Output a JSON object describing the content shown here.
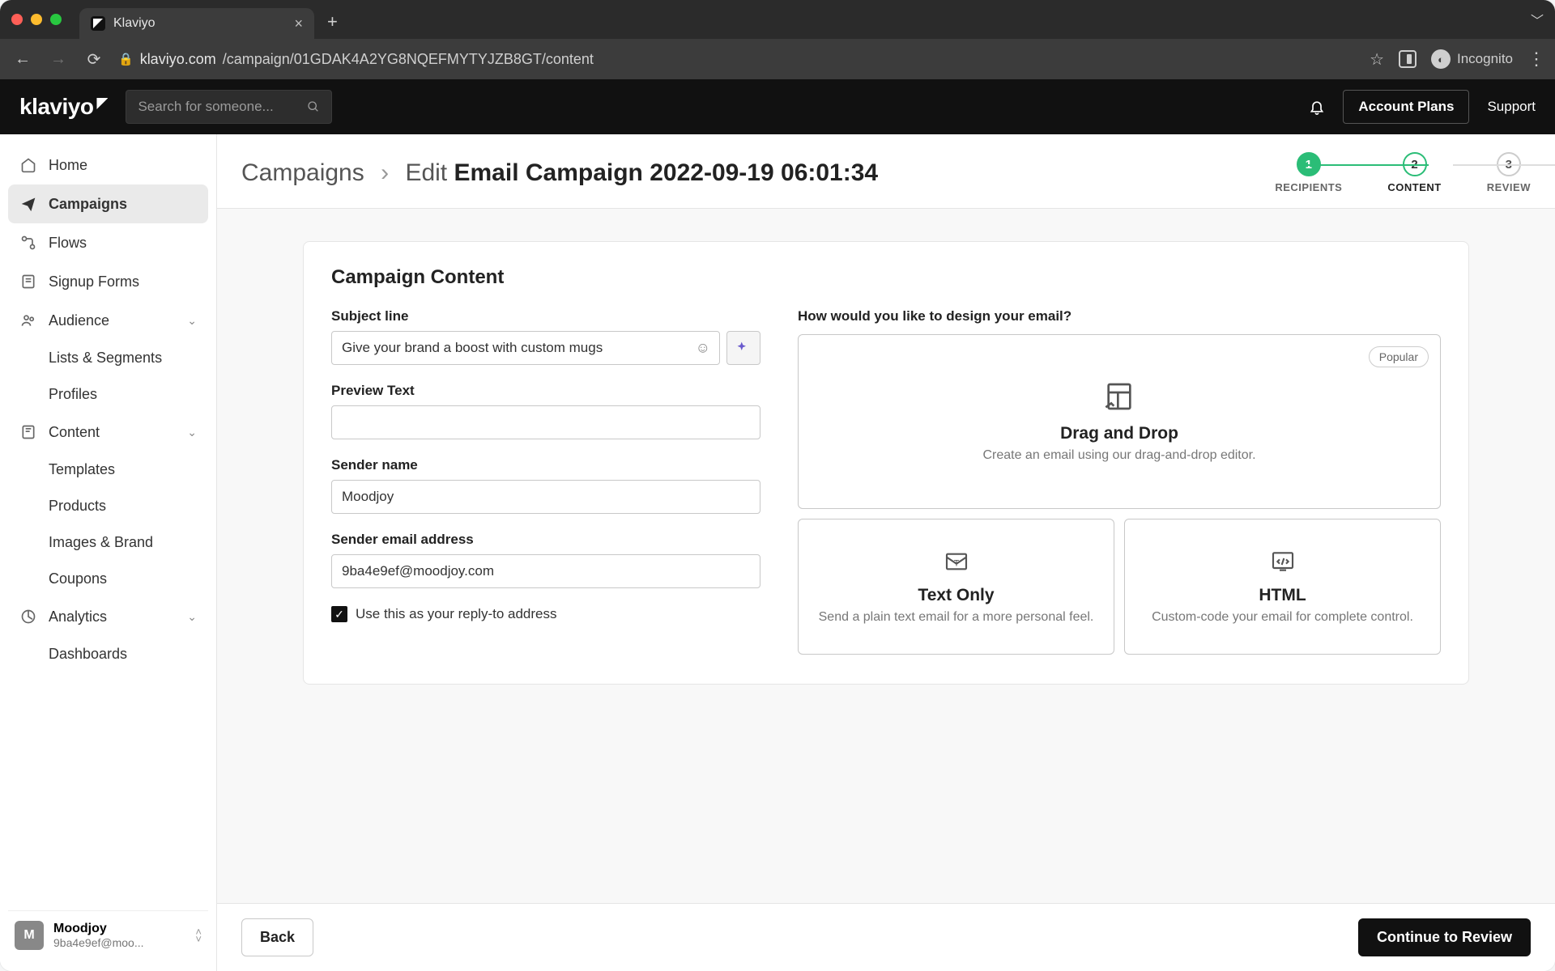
{
  "browser": {
    "tab_title": "Klaviyo",
    "url_host": "klaviyo.com",
    "url_path": "/campaign/01GDAK4A2YG8NQEFMYTYJZB8GT/content",
    "incognito_label": "Incognito"
  },
  "header": {
    "search_placeholder": "Search for someone...",
    "account_plans": "Account Plans",
    "support": "Support",
    "logo": "klaviyo"
  },
  "sidebar": {
    "items": [
      "Home",
      "Campaigns",
      "Flows",
      "Signup Forms",
      "Audience",
      "Lists & Segments",
      "Profiles",
      "Content",
      "Templates",
      "Products",
      "Images & Brand",
      "Coupons",
      "Analytics",
      "Dashboards"
    ],
    "account": {
      "initial": "M",
      "name": "Moodjoy",
      "email": "9ba4e9ef@moo..."
    }
  },
  "breadcrumb": {
    "root": "Campaigns",
    "action": "Edit",
    "title": "Email Campaign 2022-09-19 06:01:34"
  },
  "steps": [
    {
      "num": "1",
      "label": "RECIPIENTS"
    },
    {
      "num": "2",
      "label": "CONTENT"
    },
    {
      "num": "3",
      "label": "REVIEW"
    }
  ],
  "panel": {
    "heading": "Campaign Content",
    "subject_label": "Subject line",
    "subject_value": "Give your brand a boost with custom mugs",
    "preview_label": "Preview Text",
    "preview_value": "",
    "sender_name_label": "Sender name",
    "sender_name_value": "Moodjoy",
    "sender_email_label": "Sender email address",
    "sender_email_value": "9ba4e9ef@moodjoy.com",
    "replyto_label": "Use this as your reply-to address",
    "design_label": "How would you like to design your email?",
    "popular_badge": "Popular",
    "options": [
      {
        "title": "Drag and Drop",
        "desc": "Create an email using our drag-and-drop editor."
      },
      {
        "title": "Text Only",
        "desc": "Send a plain text email for a more personal feel."
      },
      {
        "title": "HTML",
        "desc": "Custom-code your email for complete control."
      }
    ]
  },
  "footer": {
    "back": "Back",
    "continue": "Continue to Review"
  }
}
